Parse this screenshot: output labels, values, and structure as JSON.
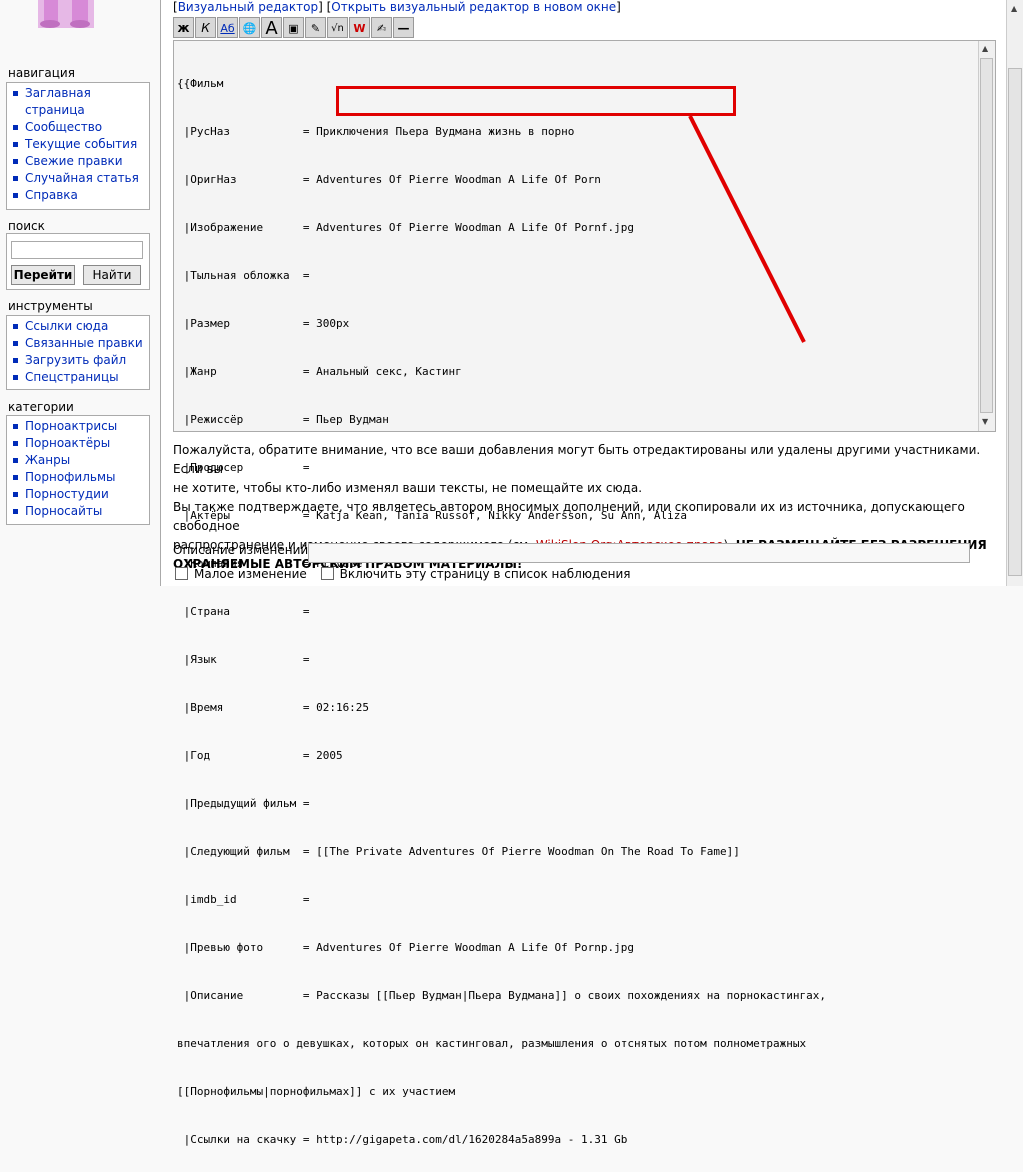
{
  "sidebar": {
    "nav_heading": "навигация",
    "nav_items": [
      "Заглавная",
      "страница",
      "Сообщество",
      "Текущие события",
      "Свежие правки",
      "Случайная статья",
      "Справка"
    ],
    "search_heading": "поиск",
    "search_go": "Перейти",
    "search_find": "Найти",
    "tools_heading": "инструменты",
    "tools_items": [
      "Ссылки сюда",
      "Связанные правки",
      "Загрузить файл",
      "Спецстраницы"
    ],
    "cat_heading": "категории",
    "cat_items": [
      "Порноактрисы",
      "Порноактёры",
      "Жанры",
      "Порнофильмы",
      "Порностудии",
      "Порносайты"
    ]
  },
  "editor": {
    "visual_link": "Визуальный редактор",
    "visual_new_window": "Открыть визуальный редактор в новом окне",
    "toolbar": [
      "ж",
      "К",
      "Аб",
      "🌐",
      "A",
      "▣",
      "✎",
      "√n",
      "W",
      "✍",
      "—"
    ],
    "lines": [
      "{{Фильм",
      " |РусНаз           = Приключения Пьера Вудмана жизнь в порно",
      " |ОригНаз          = Adventures Of Pierre Woodman A Life Of Porn",
      " |Изображение      = Adventures Of Pierre Woodman A Life Of Pornf.jpg",
      " |Тыльная обложка  =",
      " |Размер           = 300px",
      " |Жанр             = Анальный секс, Кастинг",
      " |Режиссёр         = Пьер Вудман",
      " |Продюсер         =",
      " |Актёры           = Katja Kean, Tania Russof, Nikky Andersson, Su Ann, Aliza",
      " |Компания         = Private",
      " |Страна           =",
      " |Язык             =",
      " |Время            = 02:16:25",
      " |Год              = 2005",
      " |Предыдущий фильм =",
      " |Следующий фильм  = [[The Private Adventures Of Pierre Woodman On The Road To Fame]]",
      " |imdb_id          =",
      " |Превью фото      = Adventures Of Pierre Woodman A Life Of Pornp.jpg",
      " |Описание         = Рассказы [[Пьер Вудман|Пьера Вудмана]] о своих похождениях на порнокастингах,",
      "впечатления ого о девушках, которых он кастинговал, размышления о отснятых потом полнометражных",
      "[[Порнофильмы|порнофильмах]] с их участием",
      " |Ссылки на скачку = http://gigapeta.com/dl/1620284a5a899a - 1.31 Gb",
      "}}"
    ]
  },
  "notice": {
    "line1": "Пожалуйста, обратите внимание, что все ваши добавления могут быть отредактированы или удалены другими участниками. Если вы",
    "line2": "не хотите, чтобы кто-либо изменял ваши тексты, не помещайте их сюда.",
    "line3": "Вы также подтверждаете, что являетесь автором вносимых дополнений, или скопировали их из источника, допускающего свободное",
    "line4a": "распространение и изменение своего содержимого (см. ",
    "line4link": "WikiSlon.Org:Авторское право",
    "line4b": "). ",
    "warn1": "НЕ РАЗМЕЩАЙТЕ БЕЗ РАЗРЕШЕНИЯ",
    "warn2": "ОХРАНЯЕМЫЕ АВТОРСКИМ ПРАВОМ МАТЕРИАЛЫ!"
  },
  "form": {
    "summary_label": "Описание изменений:",
    "minor_edit": "Малое изменение",
    "watch_page": "Включить эту страницу в список наблюдения"
  },
  "colors": {
    "annotation": "#e00000",
    "link": "#002bb8"
  }
}
